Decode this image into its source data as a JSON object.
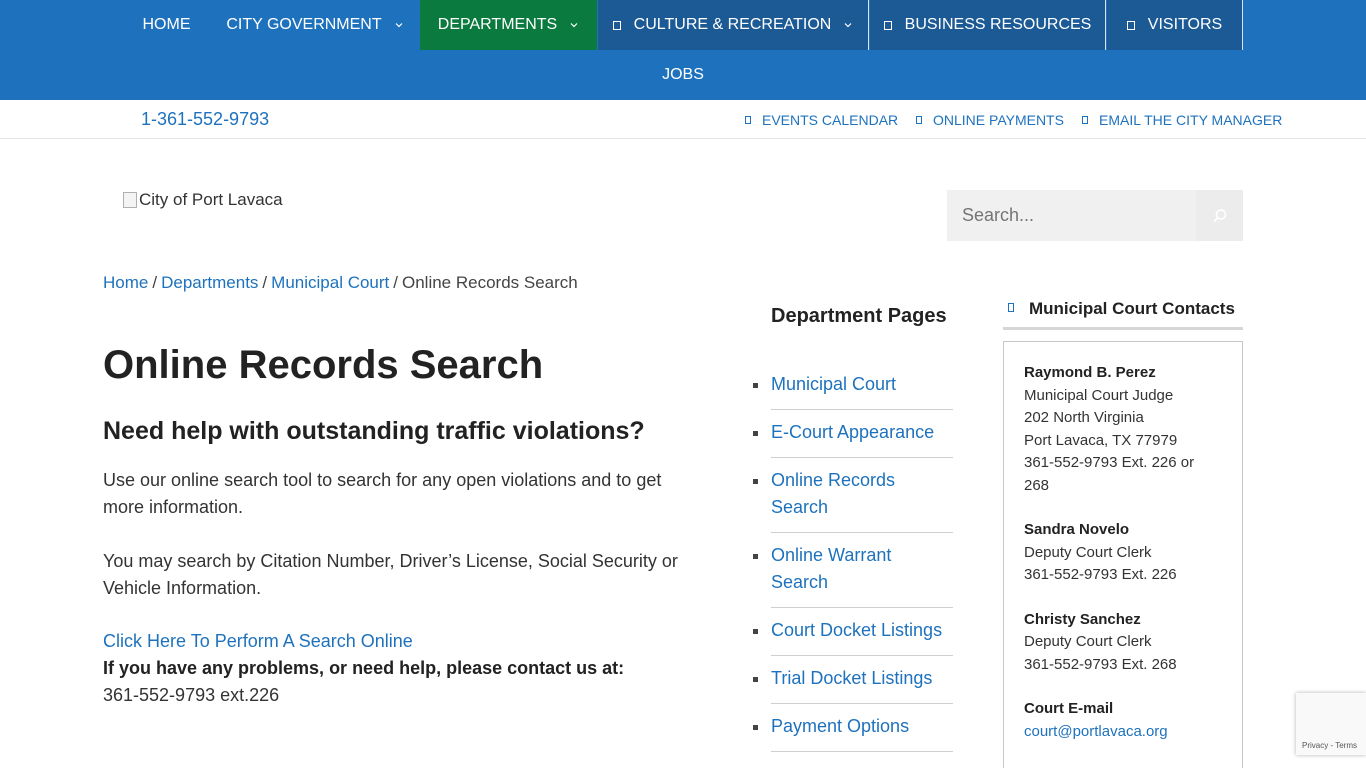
{
  "nav": {
    "items": [
      {
        "label": "HOME"
      },
      {
        "label": "CITY GOVERNMENT"
      },
      {
        "label": "DEPARTMENTS"
      },
      {
        "label": "CULTURE & RECREATION"
      },
      {
        "label": "BUSINESS RESOURCES"
      },
      {
        "label": "VISITORS"
      }
    ],
    "jobs_label": "JOBS",
    "colors": {
      "bar": "#1e72bd",
      "active": "#0b7a3e",
      "dark": "#1c5a95"
    }
  },
  "utility": {
    "phone": "1-361-552-9793",
    "links": [
      {
        "label": "EVENTS CALENDAR"
      },
      {
        "label": "ONLINE PAYMENTS"
      },
      {
        "label": "EMAIL THE CITY MANAGER"
      }
    ]
  },
  "header": {
    "logo_alt": "City of Port Lavaca",
    "search_placeholder": "Search...",
    "search_icon": "search-icon"
  },
  "breadcrumb": {
    "items": [
      "Home",
      "Departments",
      "Municipal Court"
    ],
    "separator": "/",
    "current": "Online Records Search"
  },
  "main": {
    "title": "Online Records Search",
    "subheading": "Need help with outstanding traffic violations?",
    "para1": "Use our online search tool to search for any open violations and to get more information.",
    "para2": "You may search by Citation Number, Driver’s License, Social Security or Vehicle Information.",
    "search_link": "Click Here To Perform A Search Online",
    "help_text": "If you have any problems, or need help, please contact us at:",
    "help_phone": "361-552-9793 ext.226"
  },
  "dept_pages": {
    "title": "Department Pages",
    "items": [
      {
        "label": "Municipal Court"
      },
      {
        "label": "E-Court Appearance"
      },
      {
        "label": "Online Records Search"
      },
      {
        "label": "Online Warrant Search"
      },
      {
        "label": "Court Docket Listings"
      },
      {
        "label": "Trial Docket Listings"
      },
      {
        "label": "Payment Options"
      }
    ]
  },
  "contacts": {
    "title": "Municipal Court Contacts",
    "people": [
      {
        "name": "Raymond B. Perez",
        "role": "Municipal Court Judge",
        "address1": "202 North Virginia",
        "address2": "Port Lavaca, TX 77979",
        "phone": "361-552-9793 Ext. 226 or 268"
      },
      {
        "name": "Sandra Novelo",
        "role": "Deputy Court Clerk",
        "phone": "361-552-9793 Ext. 226"
      },
      {
        "name": "Christy Sanchez",
        "role": "Deputy Court Clerk",
        "phone": "361-552-9793 Ext. 268"
      }
    ],
    "email_label": "Court E-mail",
    "email": "court@portlavaca.org"
  },
  "recaptcha": {
    "privacy": "Privacy",
    "separator": "-",
    "terms": "Terms"
  }
}
